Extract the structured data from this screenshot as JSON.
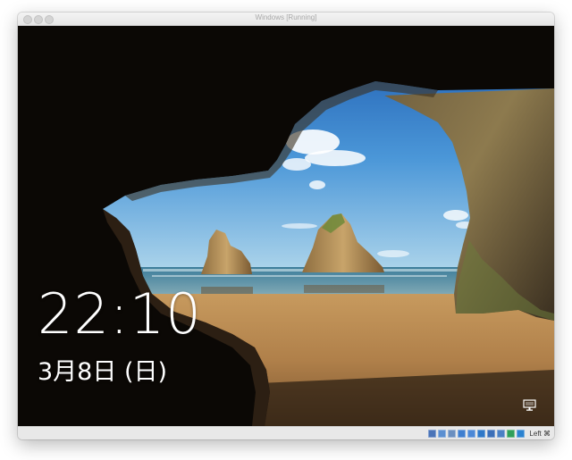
{
  "window": {
    "title": "Windows [Running]"
  },
  "lockscreen": {
    "time": "22:10",
    "date": "3月8日 (日)",
    "network_icon": "network-monitor-icon"
  },
  "statusbar": {
    "icons": [
      {
        "name": "hard-disk-icon",
        "color": "#4a74b8"
      },
      {
        "name": "optical-drive-icon",
        "color": "#5b8fd1"
      },
      {
        "name": "audio-icon",
        "color": "#6a8fc0"
      },
      {
        "name": "network-icon",
        "color": "#3f7fd0"
      },
      {
        "name": "usb-icon",
        "color": "#4c88d6"
      },
      {
        "name": "shared-folders-icon",
        "color": "#2f78c8"
      },
      {
        "name": "display-icon",
        "color": "#3b6fb8"
      },
      {
        "name": "video-capture-icon",
        "color": "#4a80c4"
      },
      {
        "name": "cpu-icon",
        "color": "#2f9f5a"
      },
      {
        "name": "mouse-integration-icon",
        "color": "#2c83d0"
      }
    ],
    "host_key": "Left ⌘"
  },
  "colors": {
    "sky_top": "#1d5fb5",
    "sky_bottom": "#9fcbe8",
    "sand": "#b8894e",
    "cave": "#0d0a07"
  }
}
